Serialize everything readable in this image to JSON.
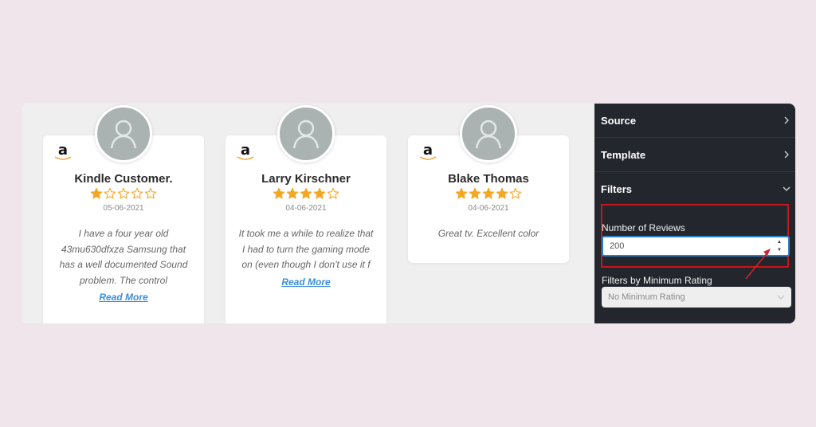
{
  "reviews": [
    {
      "source": "amazon",
      "name": "Kindle Customer.",
      "rating": 1,
      "max_rating": 5,
      "date": "05-06-2021",
      "text": "I have a four year old 43mu630dfxza Samsung that has a well documented Sound problem. The control",
      "read_more": "Read More"
    },
    {
      "source": "amazon",
      "name": "Larry Kirschner",
      "rating": 4,
      "max_rating": 5,
      "date": "04-06-2021",
      "text": "It took me a while to realize that I had to turn the gaming mode on (even though I don't use it f",
      "read_more": "Read More"
    },
    {
      "source": "amazon",
      "name": "Blake Thomas",
      "rating": 4,
      "max_rating": 5,
      "date": "04-06-2021",
      "text": "Great tv. Excellent color"
    }
  ],
  "panel": {
    "sections": [
      {
        "label": "Source",
        "state": "collapsed"
      },
      {
        "label": "Template",
        "state": "collapsed"
      },
      {
        "label": "Filters",
        "state": "expanded"
      }
    ],
    "filters": {
      "number_of_reviews_label": "Number of Reviews",
      "number_of_reviews_value": "200",
      "min_rating_label": "Filters by Minimum Rating",
      "min_rating_value": "No Minimum Rating"
    }
  },
  "colors": {
    "star": "#f5a623",
    "link": "#3b8fd9",
    "panel_bg": "#23262d",
    "highlight": "#c3181f",
    "page_bg": "#f1e5ec"
  }
}
